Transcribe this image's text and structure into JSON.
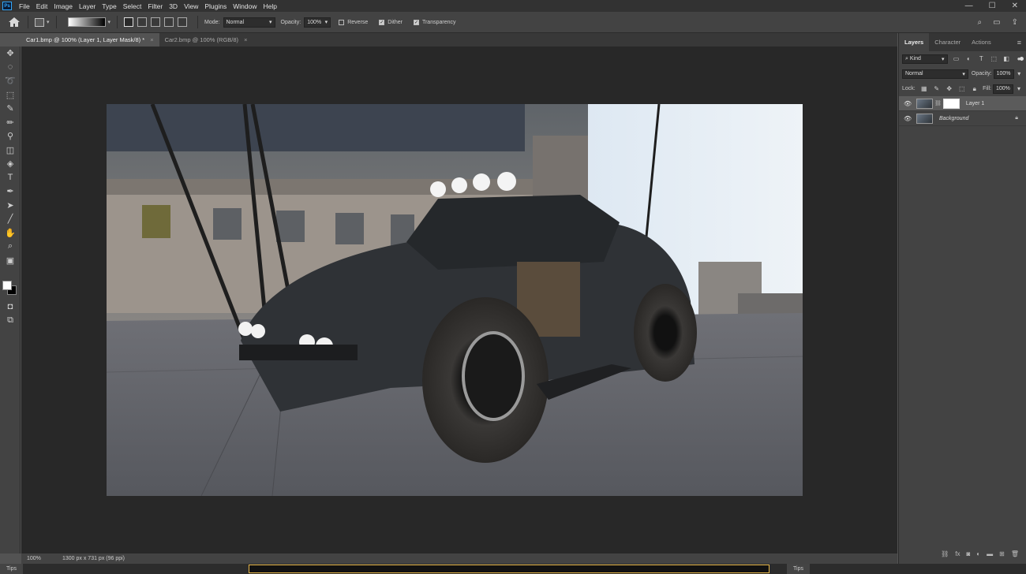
{
  "app": {
    "logo": "Ps"
  },
  "menu": [
    "File",
    "Edit",
    "Image",
    "Layer",
    "Type",
    "Select",
    "Filter",
    "3D",
    "View",
    "Plugins",
    "Window",
    "Help"
  ],
  "window_controls": [
    "—",
    "☐",
    "✕"
  ],
  "options": {
    "mode_label": "Mode:",
    "mode_value": "Normal",
    "opacity_label": "Opacity:",
    "opacity_value": "100%",
    "reverse_label": "Reverse",
    "reverse_checked": false,
    "dither_label": "Dither",
    "dither_checked": true,
    "transparency_label": "Transparency",
    "transparency_checked": true
  },
  "tabs": [
    {
      "label": "Car1.bmp @ 100% (Layer 1, Layer Mask/8) *",
      "active": true
    },
    {
      "label": "Car2.bmp @ 100% (RGB/8)",
      "active": false
    }
  ],
  "status": {
    "zoom": "100%",
    "info": "1300 px x 731 px (96 ppi)"
  },
  "tips": {
    "left": "Tips",
    "right": "Tips"
  },
  "panel": {
    "tabs": [
      "Layers",
      "Character",
      "Actions"
    ],
    "filter_kind": "Kind",
    "blend_mode": "Normal",
    "opacity_label": "Opacity:",
    "opacity_value": "100%",
    "lock_label": "Lock:",
    "fill_label": "Fill:",
    "fill_value": "100%",
    "layers": [
      {
        "name": "Layer 1",
        "selected": true,
        "has_mask": true,
        "locked": false
      },
      {
        "name": "Background",
        "selected": false,
        "has_mask": false,
        "locked": true
      }
    ]
  },
  "colors": {
    "accent": "#31a8ff",
    "canvas_bg": "#282828",
    "panel_bg": "#434343",
    "menubar_bg": "#323232"
  }
}
